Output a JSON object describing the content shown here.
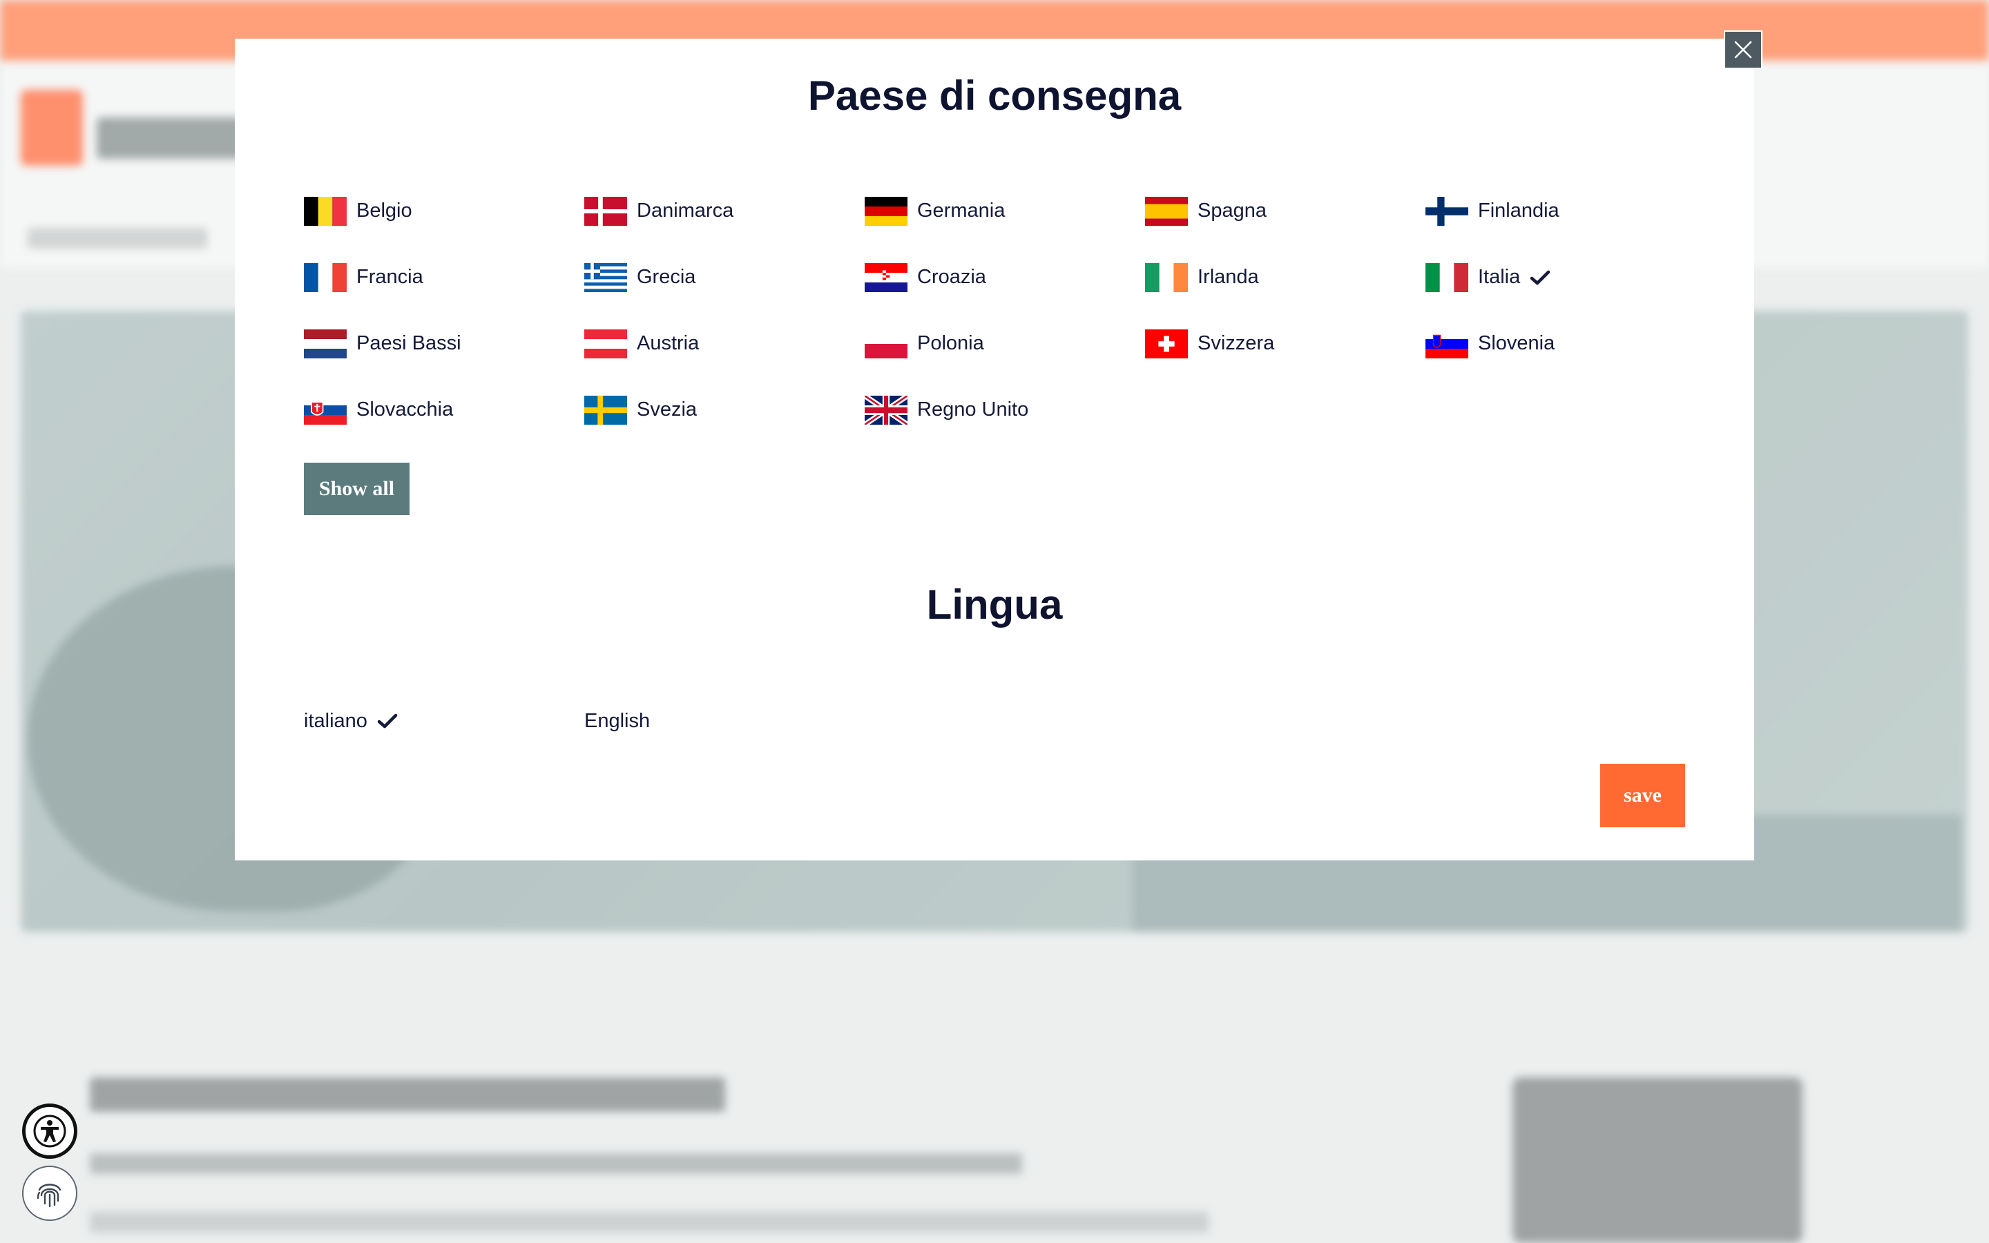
{
  "modal": {
    "country_title": "Paese di consegna",
    "language_title": "Lingua",
    "show_all_label": "Show all",
    "save_label": "save",
    "close_icon": "close-icon"
  },
  "countries": [
    {
      "name": "Belgio",
      "flag": "belgium",
      "selected": false
    },
    {
      "name": "Danimarca",
      "flag": "denmark",
      "selected": false
    },
    {
      "name": "Germania",
      "flag": "germany",
      "selected": false
    },
    {
      "name": "Spagna",
      "flag": "spain",
      "selected": false
    },
    {
      "name": "Finlandia",
      "flag": "finland",
      "selected": false
    },
    {
      "name": "Francia",
      "flag": "france",
      "selected": false
    },
    {
      "name": "Grecia",
      "flag": "greece",
      "selected": false
    },
    {
      "name": "Croazia",
      "flag": "croatia",
      "selected": false
    },
    {
      "name": "Irlanda",
      "flag": "ireland",
      "selected": false
    },
    {
      "name": "Italia",
      "flag": "italy",
      "selected": true
    },
    {
      "name": "Paesi Bassi",
      "flag": "netherlands",
      "selected": false
    },
    {
      "name": "Austria",
      "flag": "austria",
      "selected": false
    },
    {
      "name": "Polonia",
      "flag": "poland",
      "selected": false
    },
    {
      "name": "Svizzera",
      "flag": "switzerland",
      "selected": false
    },
    {
      "name": "Slovenia",
      "flag": "slovenia",
      "selected": false
    },
    {
      "name": "Slovacchia",
      "flag": "slovakia",
      "selected": false
    },
    {
      "name": "Svezia",
      "flag": "sweden",
      "selected": false
    },
    {
      "name": "Regno Unito",
      "flag": "united-kingdom",
      "selected": false
    }
  ],
  "languages": [
    {
      "name": "italiano",
      "selected": true
    },
    {
      "name": "English",
      "selected": false
    }
  ],
  "colors": {
    "accent": "#ff6a33",
    "show_all_bg": "#5b7b7d",
    "heading": "#0e1330",
    "top_bar": "#ff8c5f"
  },
  "side_widgets": {
    "accessibility_icon": "accessibility-icon",
    "fingerprint_icon": "fingerprint-icon"
  }
}
